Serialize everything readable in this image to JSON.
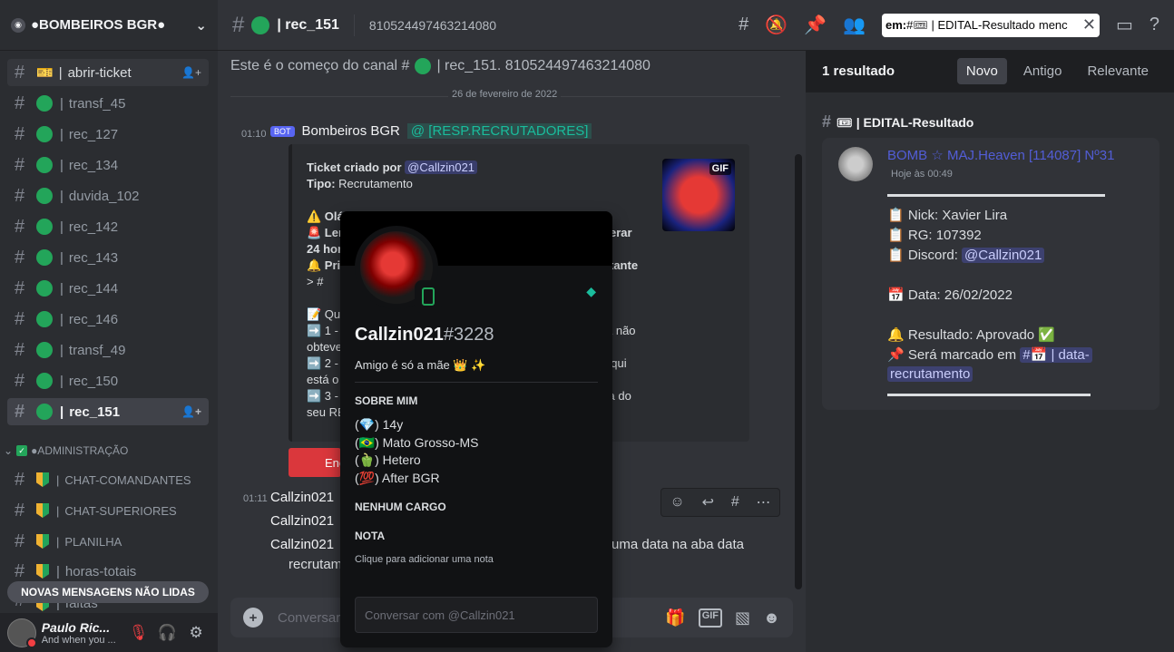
{
  "guild": {
    "name": "●BOMBEIROS BGR●"
  },
  "sidebar": {
    "channels": [
      {
        "label": "abrir-ticket",
        "type": "ticket",
        "state": "hover"
      },
      {
        "label": "transf_45"
      },
      {
        "label": "rec_127"
      },
      {
        "label": "rec_134"
      },
      {
        "label": "duvida_102"
      },
      {
        "label": "rec_142"
      },
      {
        "label": "rec_143"
      },
      {
        "label": "rec_144"
      },
      {
        "label": "rec_146"
      },
      {
        "label": "transf_49"
      },
      {
        "label": "rec_150"
      },
      {
        "label": "rec_151",
        "state": "active"
      }
    ],
    "category": "●ADMINISTRAÇÃO",
    "admin_channels": [
      "CHAT-COMANDANTES",
      "CHAT-SUPERIORES",
      "PLANILHA",
      "horas-totais",
      "faltas"
    ],
    "unread_label": "NOVAS MENSAGENS NÃO LIDAS",
    "separator": "|"
  },
  "user_panel": {
    "name": "Paulo Ric...",
    "status": "And when you ..."
  },
  "topbar": {
    "channel": "| rec_151",
    "topic": "810524497463214080",
    "search_prefix": "em:",
    "search_tag": "| EDITAL-Resultado",
    "search_tail": "menc"
  },
  "chat": {
    "welcome_prefix": "Este é o começo do canal #",
    "welcome_suffix": "| rec_151. 810524497463214080",
    "date_divider": "26 de fevereiro de 2022",
    "bot_time": "01:10",
    "bot_badge": "BOT",
    "bot_name": "Bombeiros BGR",
    "role_mention": "@ [RESP.RECRUTADORES]",
    "embed": {
      "ticket_label": "Ticket criado por",
      "ticket_user": "@Callzin021",
      "tipo_label": "Tipo:",
      "tipo_value": "Recrutamento",
      "gif_label": "GIF",
      "lines": [
        "⚠️ Olá",
        "🚨 Len",
        "24 hora",
        "🔔 Pri",
        "> #",
        "📝 Qua",
        "➡️ 1 - S",
        "obteve",
        "➡️ 2 -",
        "está o c",
        "➡️ 3 -",
        "seu REC"
      ],
      "right_lines": [
        "erar",
        "tante",
        "a não",
        "aqui",
        "ita do"
      ]
    },
    "red_button": "Enc",
    "messages": [
      {
        "time": "01:11",
        "user": "Callzin021"
      },
      {
        "user": "Callzin021"
      },
      {
        "user": "Callzin021",
        "content": "uma data na aba data",
        "content2": "recrutam"
      }
    ],
    "input_placeholder": "Conversar",
    "input_gif": "GIF"
  },
  "search_results": {
    "count": "1 resultado",
    "sorts": [
      "Novo",
      "Antigo",
      "Relevante"
    ],
    "channel": "| EDITAL-Resultado",
    "author": "BOMB ☆ MAJ.Heaven [114087] Nº31",
    "timestamp": "Hoje às 00:49",
    "nick": "Nick: Xavier Lira",
    "rg": "RG: 107392",
    "discord_label": "Discord:",
    "discord_user": "@Callzin021",
    "date": "Data: 26/02/2022",
    "result": "Resultado: Aprovado",
    "marked": "Será marcado em",
    "marked_channel": "| data-",
    "marked_channel2": "recrutamento"
  },
  "popout": {
    "username": "Callzin021",
    "discriminator": "#3228",
    "custom_status": "Amigo é só a mãe 👑 ✨",
    "about_title": "SOBRE MIM",
    "about": [
      "(💎) 14y",
      "(🇧🇷) Mato Grosso-MS",
      "(🫑) Hetero",
      "(💯) After BGR"
    ],
    "no_roles": "NENHUM CARGO",
    "note_title": "NOTA",
    "note_placeholder": "Clique para adicionar uma nota",
    "dm_placeholder": "Conversar com @Callzin021"
  },
  "colors": {
    "online": "#23a55a",
    "blurple": "#5865f2",
    "danger": "#da373c"
  }
}
